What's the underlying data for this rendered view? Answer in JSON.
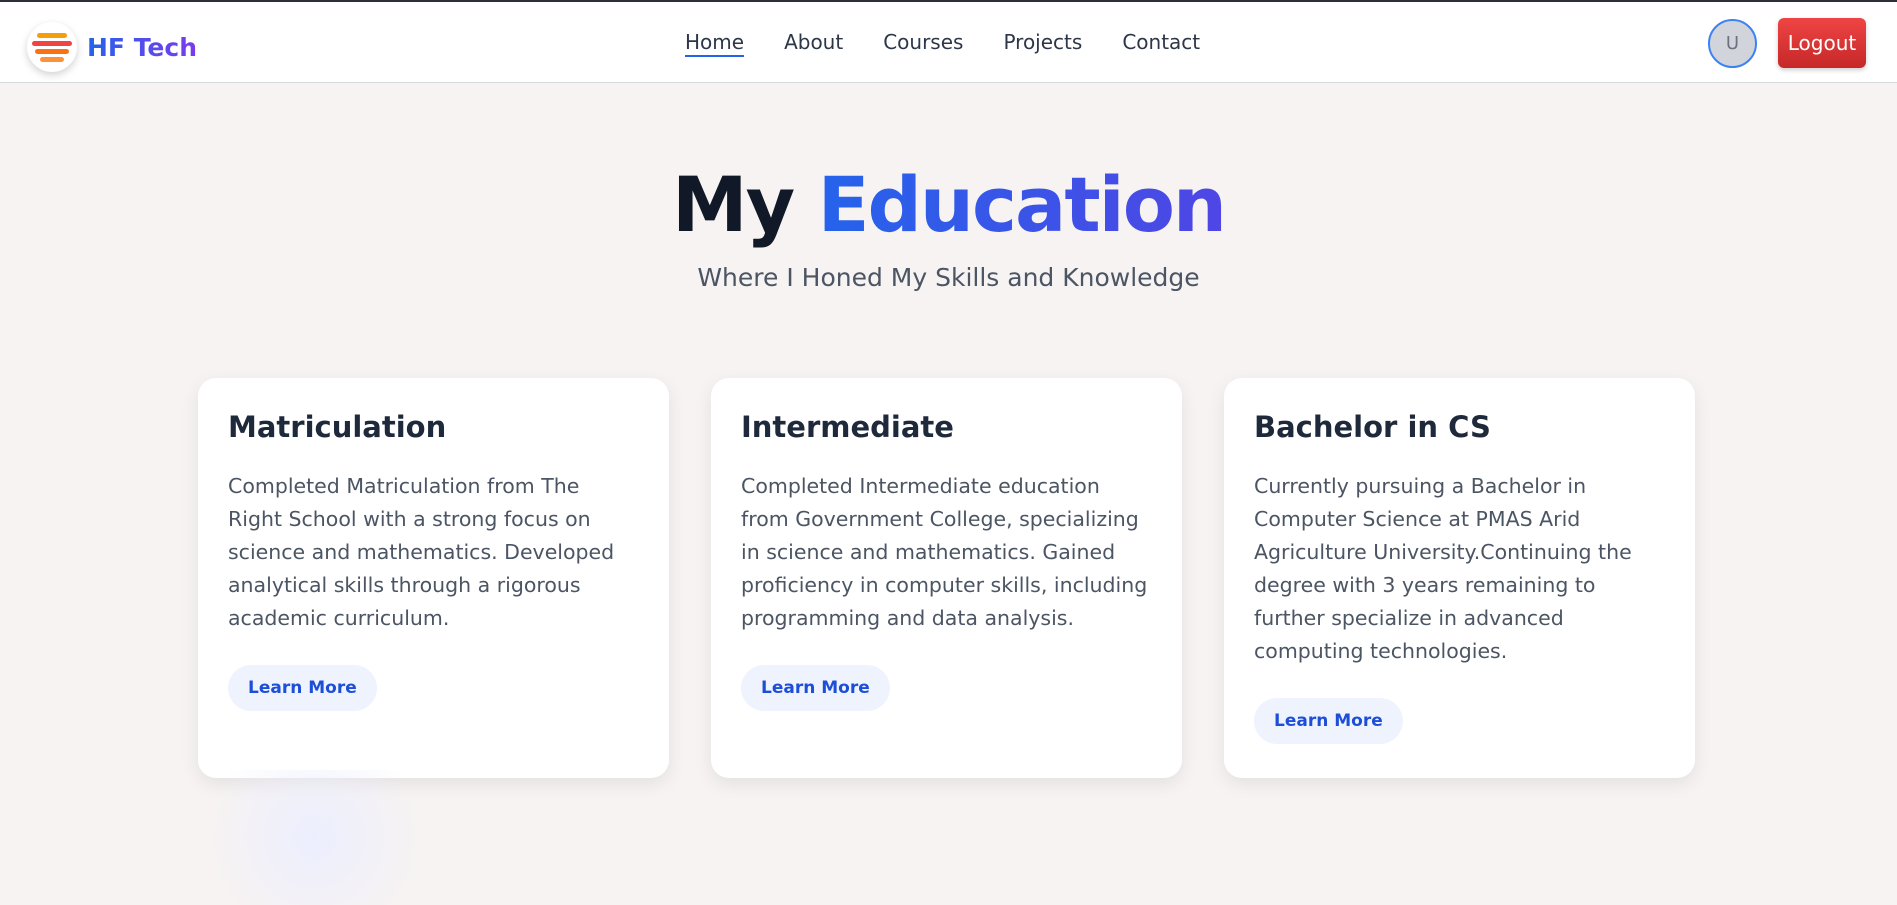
{
  "brand": {
    "name": "HF Tech"
  },
  "nav": {
    "items": [
      "Home",
      "About",
      "Courses",
      "Projects",
      "Contact"
    ],
    "active": "Home"
  },
  "user": {
    "avatar_initial": "U",
    "logout_label": "Logout"
  },
  "hero": {
    "title_part1": "My",
    "title_part2": "Education",
    "subtitle": "Where I Honed My Skills and Knowledge"
  },
  "cards": [
    {
      "title": "Matriculation",
      "text": "Completed Matriculation from The Right School with a strong focus on science and mathematics. Developed analytical skills through a rigorous academic curriculum.",
      "button": "Learn More"
    },
    {
      "title": "Intermediate",
      "text": "Completed Intermediate education from Government College, specializing in science and mathematics. Gained proficiency in computer skills, including programming and data analysis.",
      "button": "Learn More"
    },
    {
      "title": "Bachelor in CS",
      "text": "Currently pursuing a Bachelor in Computer Science at PMAS Arid Agriculture University.Continuing the degree with 3 years remaining to further specialize in advanced computing technologies.",
      "button": "Learn More"
    }
  ],
  "colors": {
    "accent": "#2563eb",
    "logout": "#dc2626",
    "background": "#f7f3f2"
  }
}
